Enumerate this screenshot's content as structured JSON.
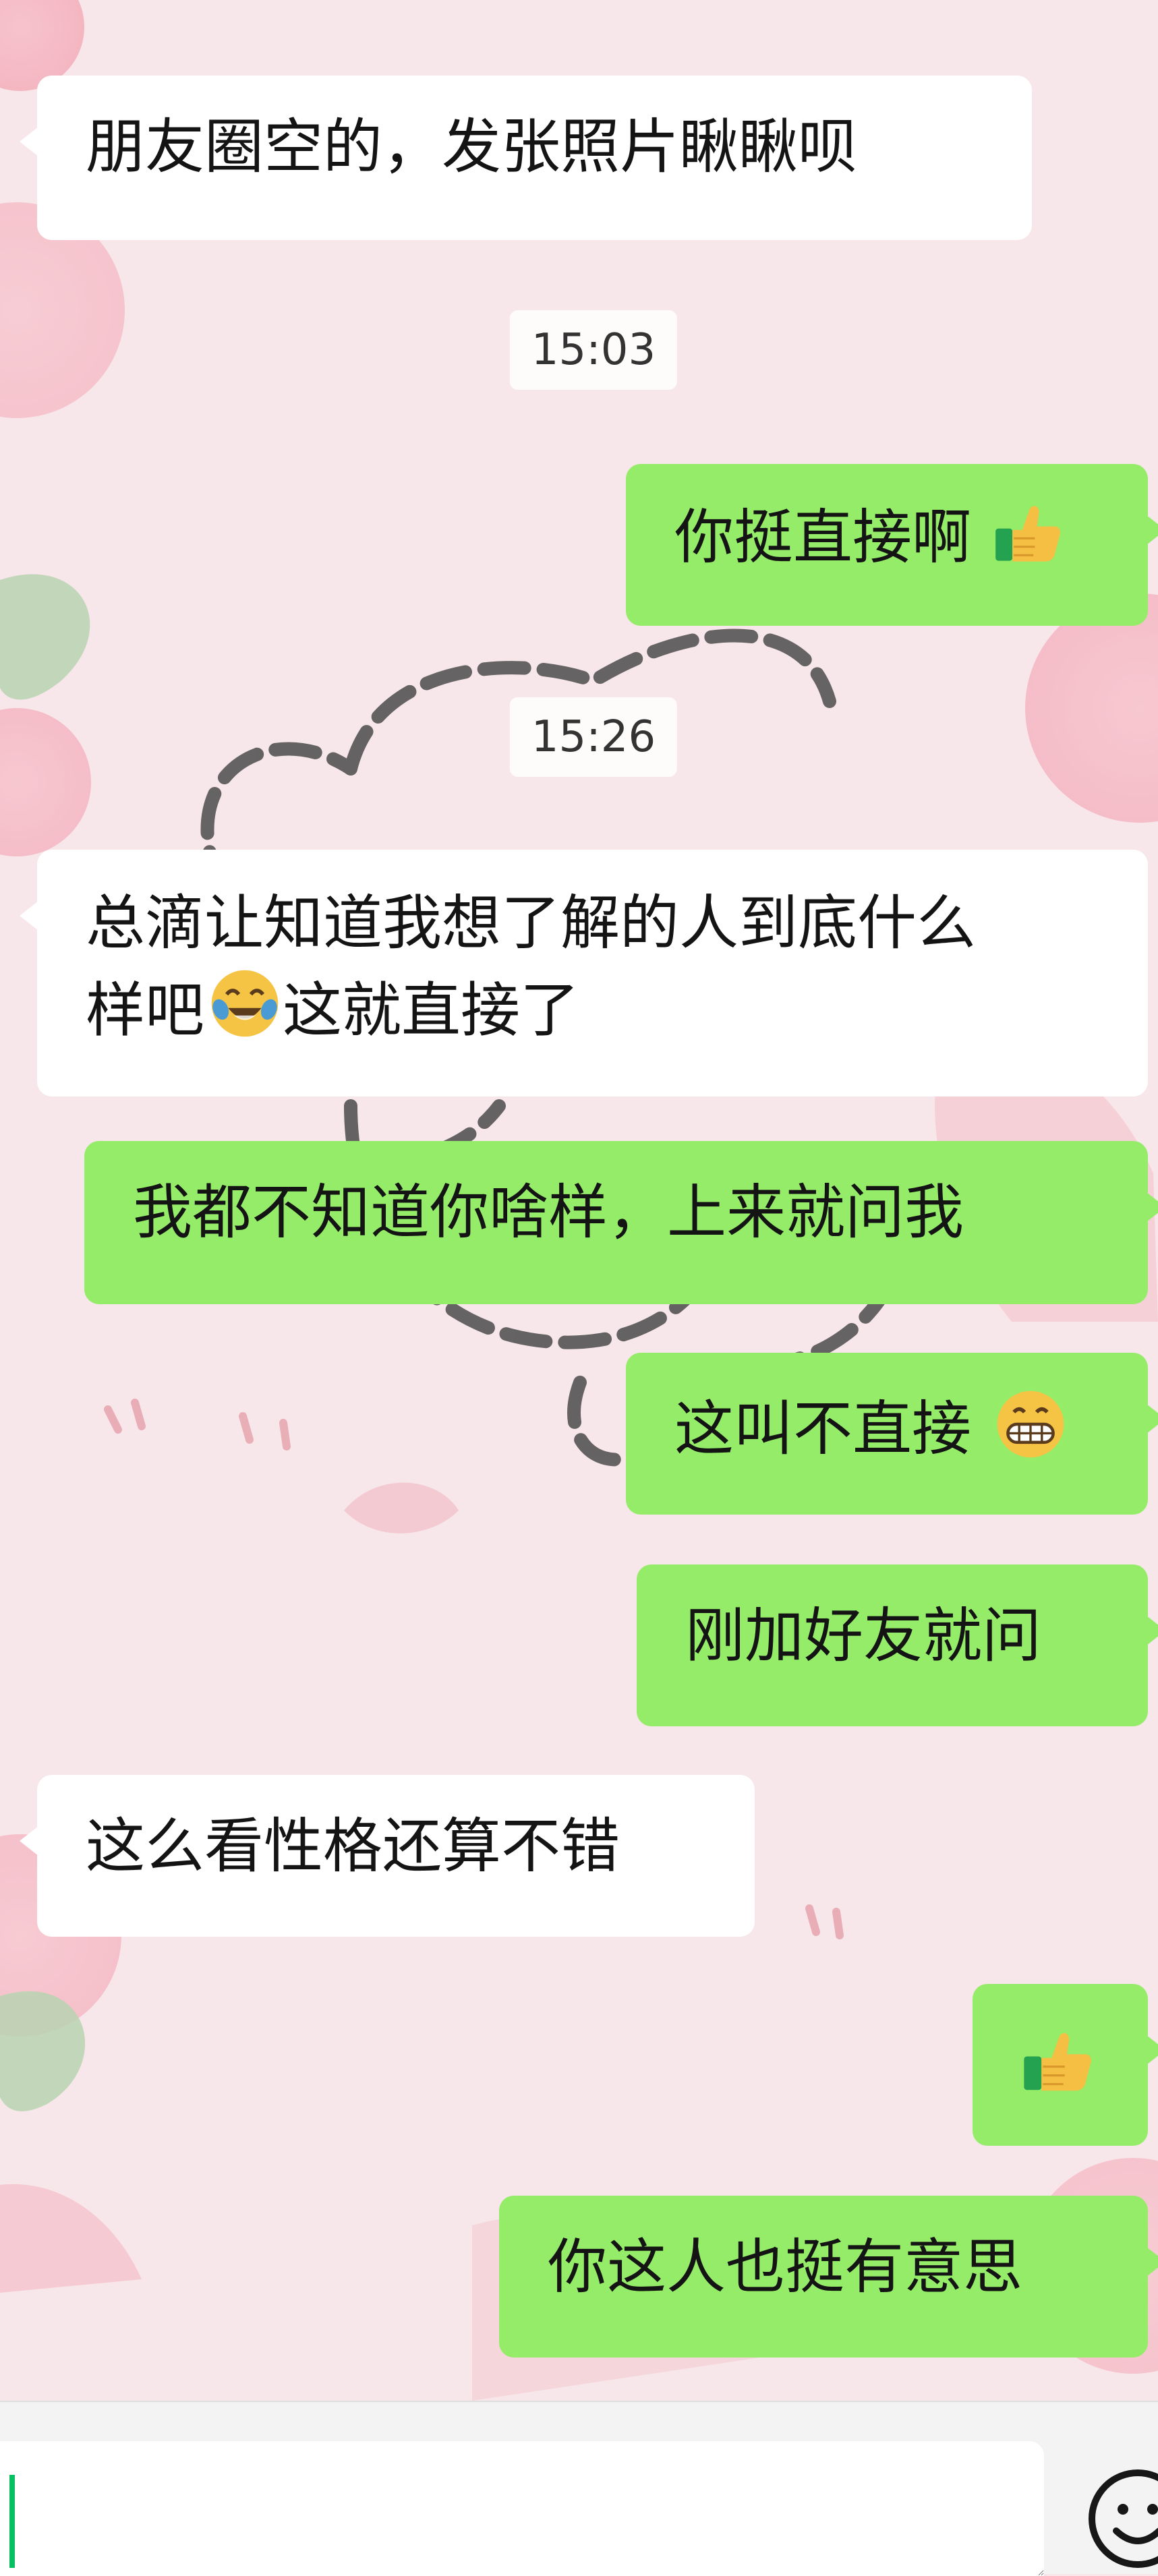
{
  "conversation": {
    "messages": [
      {
        "id": "m1",
        "side": "left",
        "text": "朋友圈空的，发张照片瞅瞅呗"
      },
      {
        "id": "t1",
        "type": "timestamp",
        "text": "15:03"
      },
      {
        "id": "m2",
        "side": "right",
        "text": "你挺直接啊",
        "emoji": "thumbs-up-icon"
      },
      {
        "id": "t2",
        "type": "timestamp",
        "text": "15:26"
      },
      {
        "id": "m3",
        "side": "left",
        "lines": [
          "总滴让知道我想了解的人到底什么",
          "样吧"
        ],
        "emoji": "laughing-crying-emoji-icon",
        "after": "这就直接了"
      },
      {
        "id": "m4",
        "side": "right",
        "text": "我都不知道你啥样，上来就问我"
      },
      {
        "id": "m5",
        "side": "right",
        "text": "这叫不直接",
        "emoji": "grinning-emoji-icon"
      },
      {
        "id": "m6",
        "side": "right",
        "text": "刚加好友就问"
      },
      {
        "id": "m7",
        "side": "left",
        "text": "这么看性格还算不错"
      },
      {
        "id": "m8",
        "side": "right",
        "emoji": "thumbs-up-icon"
      },
      {
        "id": "m9",
        "side": "right",
        "text": "你这人也挺有意思"
      }
    ]
  },
  "input": {
    "value": "",
    "placeholder": ""
  },
  "colors": {
    "background": "#f8e6ea",
    "incoming_bubble": "#ffffff",
    "outgoing_bubble": "#95ec69",
    "cursor": "#07c160",
    "thumb": "#f5bf44",
    "sleeve": "#25a24f"
  }
}
